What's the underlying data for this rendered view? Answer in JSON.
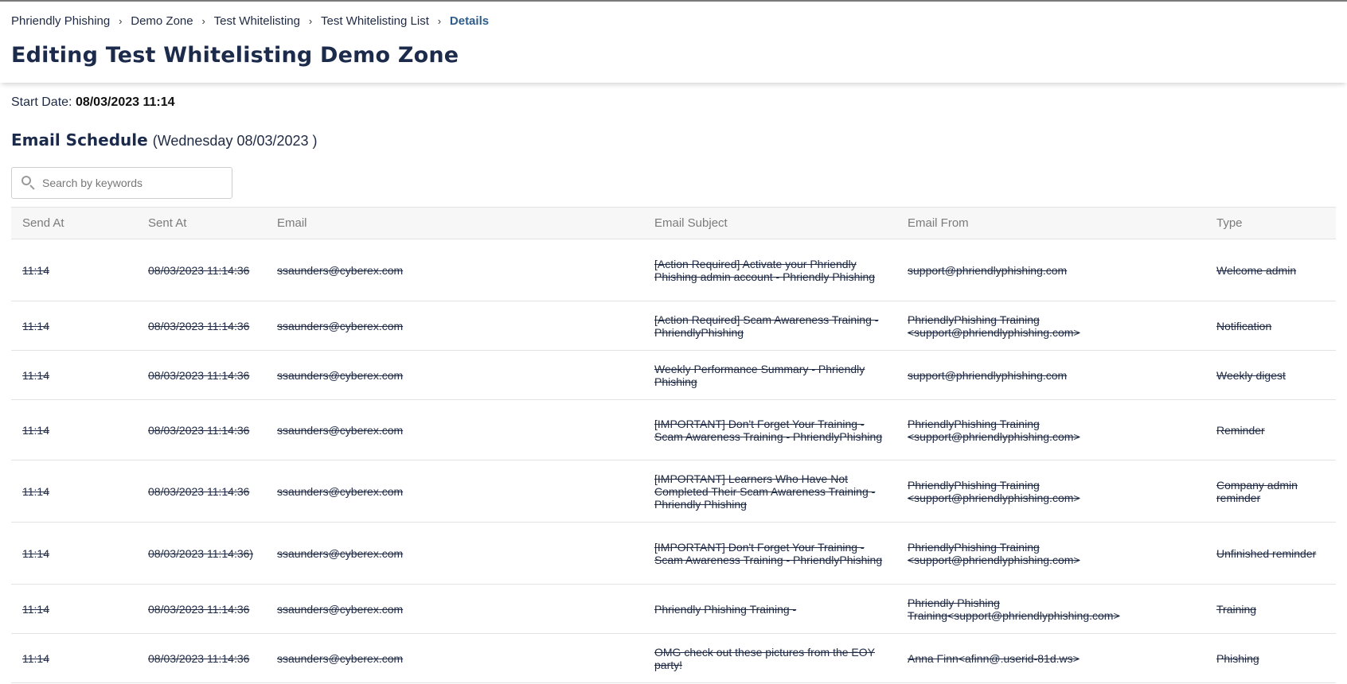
{
  "breadcrumb": {
    "items": [
      "Phriendly Phishing",
      "Demo Zone",
      "Test Whitelisting",
      "Test Whitelisting List"
    ],
    "current": "Details",
    "separator": "›"
  },
  "page_title": "Editing Test Whitelisting Demo Zone",
  "start_date": {
    "label": "Start Date:",
    "value": "08/03/2023 11:14"
  },
  "schedule": {
    "title": "Email Schedule",
    "date": "(Wednesday 08/03/2023 )"
  },
  "search": {
    "placeholder": "Search by keywords",
    "value": "",
    "icon": "search-icon"
  },
  "table": {
    "columns": [
      "Send At",
      "Sent At",
      "Email",
      "Email Subject",
      "Email From",
      "Type"
    ],
    "rows": [
      {
        "send_at": "11:14",
        "sent_at": "08/03/2023 11:14:36",
        "email": "ssaunders@cyberex.com",
        "subject": "[Action Required] Activate your Phriendly Phishing admin account - Phriendly Phishing",
        "from": "support@phriendlyphishing.com",
        "type": "Welcome admin"
      },
      {
        "send_at": "11:14",
        "sent_at": "08/03/2023 11:14:36",
        "email": "ssaunders@cyberex.com",
        "subject": "[Action Required] Scam Awareness Training - PhriendlyPhishing",
        "from": "PhriendlyPhishing Training <support@phriendlyphishing.com>",
        "type": "Notification"
      },
      {
        "send_at": "11:14",
        "sent_at": "08/03/2023 11:14:36",
        "email": "ssaunders@cyberex.com",
        "subject": "Weekly Performance Summary - Phriendly Phishing",
        "from": "support@phriendlyphishing.com",
        "type": "Weekly digest"
      },
      {
        "send_at": "11:14",
        "sent_at": "08/03/2023 11:14:36",
        "email": "ssaunders@cyberex.com",
        "subject": "[IMPORTANT] Don't Forget Your Training - Scam Awareness Training - PhriendlyPhishing",
        "from": "PhriendlyPhishing Training <support@phriendlyphishing.com>",
        "type": "Reminder"
      },
      {
        "send_at": "11:14",
        "sent_at": "08/03/2023 11:14:36",
        "email": "ssaunders@cyberex.com",
        "subject": "[IMPORTANT] Learners Who Have Not Completed Their Scam Awareness Training - Phriendly Phishing",
        "from": "PhriendlyPhishing Training <support@phriendlyphishing.com>",
        "type": "Company admin reminder"
      },
      {
        "send_at": "11:14",
        "sent_at": "08/03/2023 11:14:36)",
        "email": "ssaunders@cyberex.com",
        "subject": "[IMPORTANT] Don't Forget Your Training - Scam Awareness Training - PhriendlyPhishing",
        "from": "PhriendlyPhishing Training <support@phriendlyphishing.com>",
        "type": "Unfinished reminder"
      },
      {
        "send_at": "11:14",
        "sent_at": "08/03/2023 11:14:36",
        "email": "ssaunders@cyberex.com",
        "subject": "Phriendly Phishing Training -",
        "from": "Phriendly Phishing Training<support@phriendlyphishing.com>",
        "type": "Training"
      },
      {
        "send_at": "11:14",
        "sent_at": "08/03/2023 11:14:36",
        "email": "ssaunders@cyberex.com",
        "subject": "OMG check out these pictures from the EOY party!",
        "from": "Anna Finn<afinn@.userid-81d.ws>",
        "type": "Phishing"
      }
    ]
  }
}
